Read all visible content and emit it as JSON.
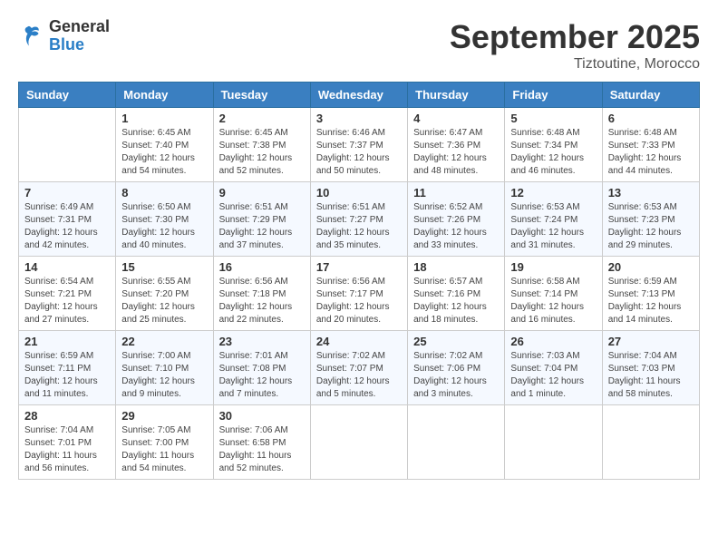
{
  "header": {
    "logo_general": "General",
    "logo_blue": "Blue",
    "month": "September 2025",
    "location": "Tiztoutine, Morocco"
  },
  "weekdays": [
    "Sunday",
    "Monday",
    "Tuesday",
    "Wednesday",
    "Thursday",
    "Friday",
    "Saturday"
  ],
  "weeks": [
    [
      {
        "day": "",
        "info": ""
      },
      {
        "day": "1",
        "info": "Sunrise: 6:45 AM\nSunset: 7:40 PM\nDaylight: 12 hours\nand 54 minutes."
      },
      {
        "day": "2",
        "info": "Sunrise: 6:45 AM\nSunset: 7:38 PM\nDaylight: 12 hours\nand 52 minutes."
      },
      {
        "day": "3",
        "info": "Sunrise: 6:46 AM\nSunset: 7:37 PM\nDaylight: 12 hours\nand 50 minutes."
      },
      {
        "day": "4",
        "info": "Sunrise: 6:47 AM\nSunset: 7:36 PM\nDaylight: 12 hours\nand 48 minutes."
      },
      {
        "day": "5",
        "info": "Sunrise: 6:48 AM\nSunset: 7:34 PM\nDaylight: 12 hours\nand 46 minutes."
      },
      {
        "day": "6",
        "info": "Sunrise: 6:48 AM\nSunset: 7:33 PM\nDaylight: 12 hours\nand 44 minutes."
      }
    ],
    [
      {
        "day": "7",
        "info": "Sunrise: 6:49 AM\nSunset: 7:31 PM\nDaylight: 12 hours\nand 42 minutes."
      },
      {
        "day": "8",
        "info": "Sunrise: 6:50 AM\nSunset: 7:30 PM\nDaylight: 12 hours\nand 40 minutes."
      },
      {
        "day": "9",
        "info": "Sunrise: 6:51 AM\nSunset: 7:29 PM\nDaylight: 12 hours\nand 37 minutes."
      },
      {
        "day": "10",
        "info": "Sunrise: 6:51 AM\nSunset: 7:27 PM\nDaylight: 12 hours\nand 35 minutes."
      },
      {
        "day": "11",
        "info": "Sunrise: 6:52 AM\nSunset: 7:26 PM\nDaylight: 12 hours\nand 33 minutes."
      },
      {
        "day": "12",
        "info": "Sunrise: 6:53 AM\nSunset: 7:24 PM\nDaylight: 12 hours\nand 31 minutes."
      },
      {
        "day": "13",
        "info": "Sunrise: 6:53 AM\nSunset: 7:23 PM\nDaylight: 12 hours\nand 29 minutes."
      }
    ],
    [
      {
        "day": "14",
        "info": "Sunrise: 6:54 AM\nSunset: 7:21 PM\nDaylight: 12 hours\nand 27 minutes."
      },
      {
        "day": "15",
        "info": "Sunrise: 6:55 AM\nSunset: 7:20 PM\nDaylight: 12 hours\nand 25 minutes."
      },
      {
        "day": "16",
        "info": "Sunrise: 6:56 AM\nSunset: 7:18 PM\nDaylight: 12 hours\nand 22 minutes."
      },
      {
        "day": "17",
        "info": "Sunrise: 6:56 AM\nSunset: 7:17 PM\nDaylight: 12 hours\nand 20 minutes."
      },
      {
        "day": "18",
        "info": "Sunrise: 6:57 AM\nSunset: 7:16 PM\nDaylight: 12 hours\nand 18 minutes."
      },
      {
        "day": "19",
        "info": "Sunrise: 6:58 AM\nSunset: 7:14 PM\nDaylight: 12 hours\nand 16 minutes."
      },
      {
        "day": "20",
        "info": "Sunrise: 6:59 AM\nSunset: 7:13 PM\nDaylight: 12 hours\nand 14 minutes."
      }
    ],
    [
      {
        "day": "21",
        "info": "Sunrise: 6:59 AM\nSunset: 7:11 PM\nDaylight: 12 hours\nand 11 minutes."
      },
      {
        "day": "22",
        "info": "Sunrise: 7:00 AM\nSunset: 7:10 PM\nDaylight: 12 hours\nand 9 minutes."
      },
      {
        "day": "23",
        "info": "Sunrise: 7:01 AM\nSunset: 7:08 PM\nDaylight: 12 hours\nand 7 minutes."
      },
      {
        "day": "24",
        "info": "Sunrise: 7:02 AM\nSunset: 7:07 PM\nDaylight: 12 hours\nand 5 minutes."
      },
      {
        "day": "25",
        "info": "Sunrise: 7:02 AM\nSunset: 7:06 PM\nDaylight: 12 hours\nand 3 minutes."
      },
      {
        "day": "26",
        "info": "Sunrise: 7:03 AM\nSunset: 7:04 PM\nDaylight: 12 hours\nand 1 minute."
      },
      {
        "day": "27",
        "info": "Sunrise: 7:04 AM\nSunset: 7:03 PM\nDaylight: 11 hours\nand 58 minutes."
      }
    ],
    [
      {
        "day": "28",
        "info": "Sunrise: 7:04 AM\nSunset: 7:01 PM\nDaylight: 11 hours\nand 56 minutes."
      },
      {
        "day": "29",
        "info": "Sunrise: 7:05 AM\nSunset: 7:00 PM\nDaylight: 11 hours\nand 54 minutes."
      },
      {
        "day": "30",
        "info": "Sunrise: 7:06 AM\nSunset: 6:58 PM\nDaylight: 11 hours\nand 52 minutes."
      },
      {
        "day": "",
        "info": ""
      },
      {
        "day": "",
        "info": ""
      },
      {
        "day": "",
        "info": ""
      },
      {
        "day": "",
        "info": ""
      }
    ]
  ]
}
